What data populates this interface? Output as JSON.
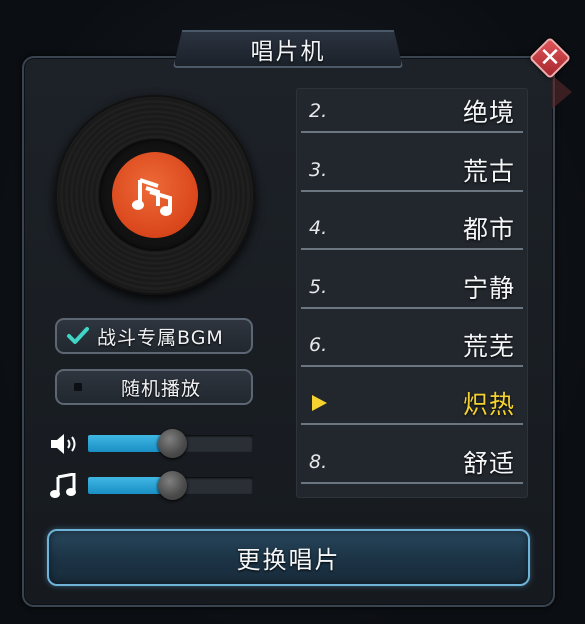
{
  "window": {
    "title": "唱片机",
    "close_icon": "close-icon"
  },
  "record": {
    "icon": "music-note-icon",
    "accent": "#e2531f"
  },
  "options": {
    "bgm_label": "战斗专属BGM",
    "bgm_checked": true,
    "random_label": "随机播放",
    "random_checked": false
  },
  "sliders": {
    "volume_level": 0.5,
    "music_level": 0.5
  },
  "tracks": [
    {
      "num": "2.",
      "name": "绝境",
      "active": false
    },
    {
      "num": "3.",
      "name": "荒古",
      "active": false
    },
    {
      "num": "4.",
      "name": "都市",
      "active": false
    },
    {
      "num": "5.",
      "name": "宁静",
      "active": false
    },
    {
      "num": "6.",
      "name": "荒芜",
      "active": false
    },
    {
      "num": "",
      "name": "炽热",
      "active": true
    },
    {
      "num": "8.",
      "name": "舒适",
      "active": false
    }
  ],
  "colors": {
    "active_track": "#f5d230",
    "slider_fill": "#2aa5d8",
    "button_border": "#6fb3d8"
  },
  "actions": {
    "change_record_label": "更换唱片"
  }
}
